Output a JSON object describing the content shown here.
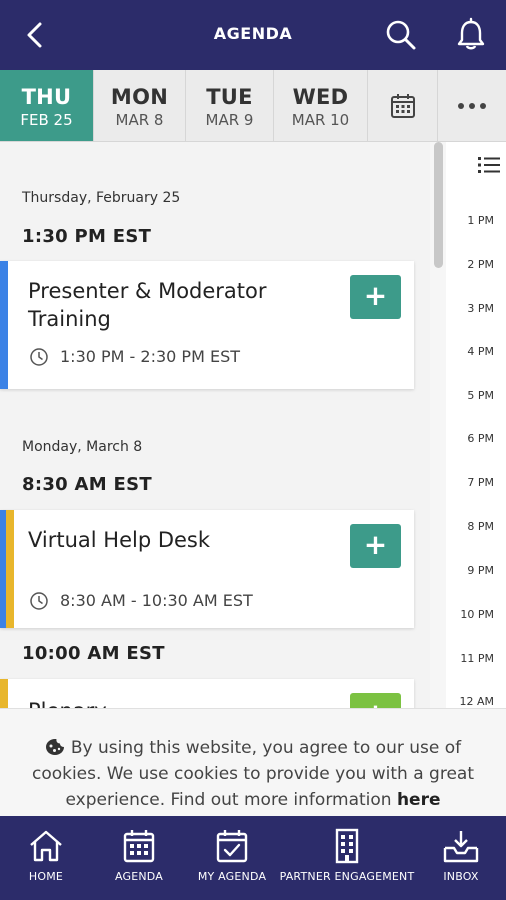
{
  "header": {
    "title": "AGENDA",
    "back_icon": "back-chevron-icon",
    "search_icon": "search-icon",
    "notifications_icon": "bell-icon"
  },
  "date_tabs": [
    {
      "dow": "THU",
      "date": "FEB 25",
      "active": true
    },
    {
      "dow": "MON",
      "date": "MAR 8",
      "active": false
    },
    {
      "dow": "TUE",
      "date": "MAR 9",
      "active": false
    },
    {
      "dow": "WED",
      "date": "MAR 10",
      "active": false
    }
  ],
  "date_tab_icons": [
    "calendar-icon",
    "more-icon"
  ],
  "sections": [
    {
      "day": "Thursday, February 25",
      "time": "1:30 PM EST",
      "session": {
        "title": "Presenter & Moderator Training",
        "time": "1:30 PM - 2:30 PM EST",
        "bar_color": "#3b82e6"
      }
    },
    {
      "day": "Monday, March 8",
      "time": "8:30 AM EST",
      "session": {
        "title": "Virtual Help Desk",
        "time": "8:30 AM - 10:30 AM EST",
        "bar_color": "#e8b62c"
      }
    },
    {
      "time": "10:00 AM EST",
      "session": {
        "title": "Plenary",
        "bar_color": "#e8b62c"
      }
    }
  ],
  "add_button_label": "+",
  "time_rail": {
    "icon": "list-view-icon",
    "hours": [
      "1 PM",
      "2 PM",
      "3 PM",
      "4 PM",
      "5 PM",
      "6 PM",
      "7 PM",
      "8 PM",
      "9 PM",
      "10 PM",
      "11 PM",
      "12 AM"
    ]
  },
  "cookie": {
    "icon": "cookie-icon",
    "text": "By using this website, you agree to our use of cookies. We use cookies to provide you with a great experience. Find out more information ",
    "link": "here"
  },
  "nav": [
    {
      "label": "HOME",
      "icon": "home-icon"
    },
    {
      "label": "AGENDA",
      "icon": "calendar-grid-icon"
    },
    {
      "label": "MY AGENDA",
      "icon": "calendar-check-icon"
    },
    {
      "label": "PARTNER ENGAGEMENT",
      "icon": "building-icon"
    },
    {
      "label": "INBOX",
      "icon": "inbox-icon"
    }
  ],
  "colors": {
    "header_bg": "#2c2c6a",
    "accent": "#3d9b8a",
    "plenary_add": "#7cc242"
  }
}
